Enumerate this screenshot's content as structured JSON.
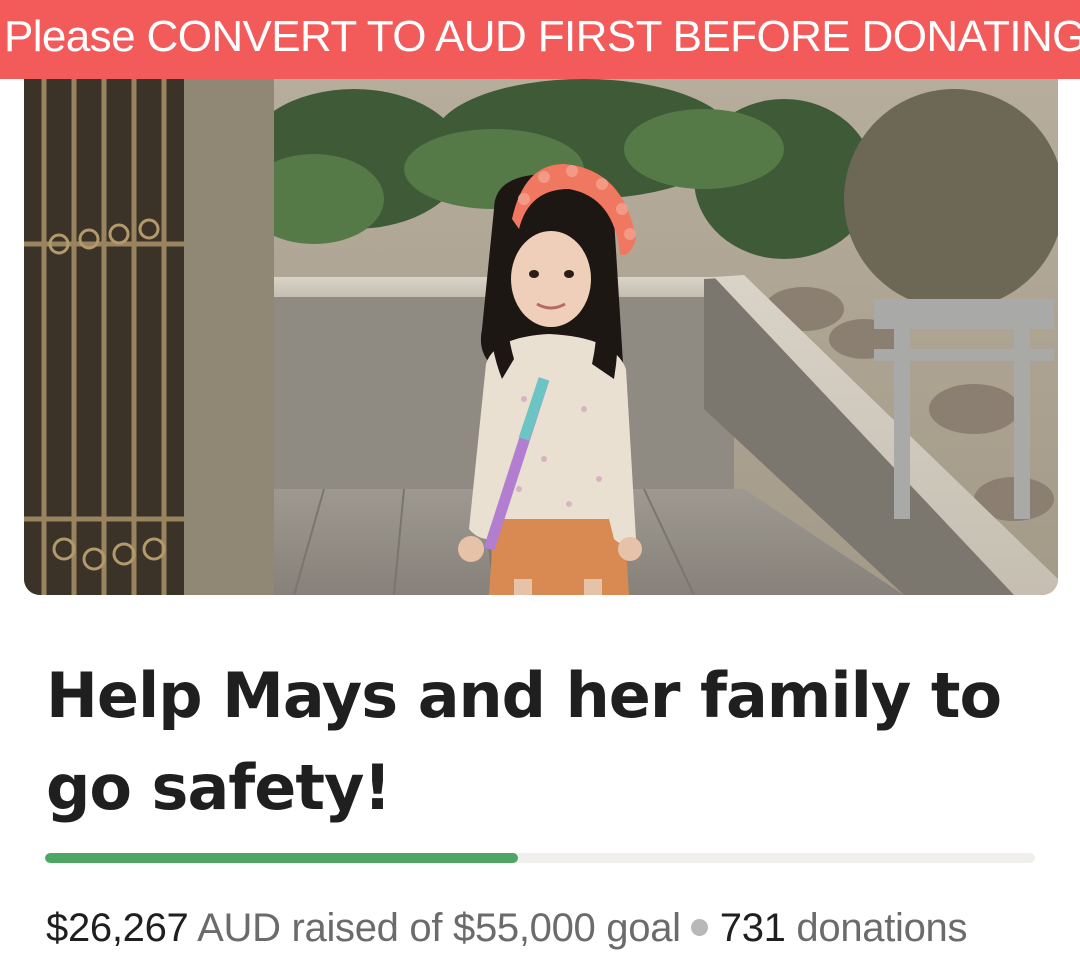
{
  "banner": {
    "text": "Please CONVERT TO AUD FIRST BEFORE DONATING",
    "color": "#f35b5b"
  },
  "campaign": {
    "photo": "campaign-photo",
    "title": "Help Mays and her family to go safety!",
    "progress_fraction": 0.4776,
    "raised_amount": "$26,267",
    "raised_suffix": "AUD raised of $55,000 goal",
    "donation_count": "731",
    "donation_label": "donations",
    "accent_color": "#4ea665"
  }
}
